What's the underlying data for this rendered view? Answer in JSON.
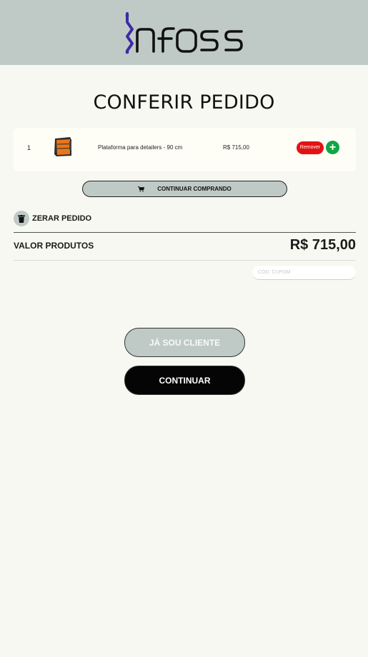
{
  "brand": {
    "logo_text": "nfoss",
    "header_color": "#bfcac7",
    "logo_accent": "#3d2ba3"
  },
  "page": {
    "title": "CONFERIR PEDIDO"
  },
  "cart": {
    "items": [
      {
        "quantity": "1",
        "image_icon": "product-cabinet-icon",
        "name": "Plataforma para detailers - 90 cm",
        "price": "R$ 715,00",
        "remove_label": "Remover",
        "add_label": "+"
      }
    ]
  },
  "actions": {
    "continue_shopping_label": "CONTINUAR COMPRANDO",
    "clear_order_label": "ZERAR PEDIDO"
  },
  "summary": {
    "products_label": "VALOR PRODUTOS",
    "products_value": "R$ 715,00",
    "coupon_placeholder": "CÓD. CUPOM"
  },
  "footer_buttons": {
    "client_label": "JÁ SOU CLIENTE",
    "continue_label": "CONTINUAR"
  },
  "colors": {
    "background": "#f6f8f1",
    "remove": "#e21313",
    "add": "#12a545",
    "continue": "#050505"
  }
}
